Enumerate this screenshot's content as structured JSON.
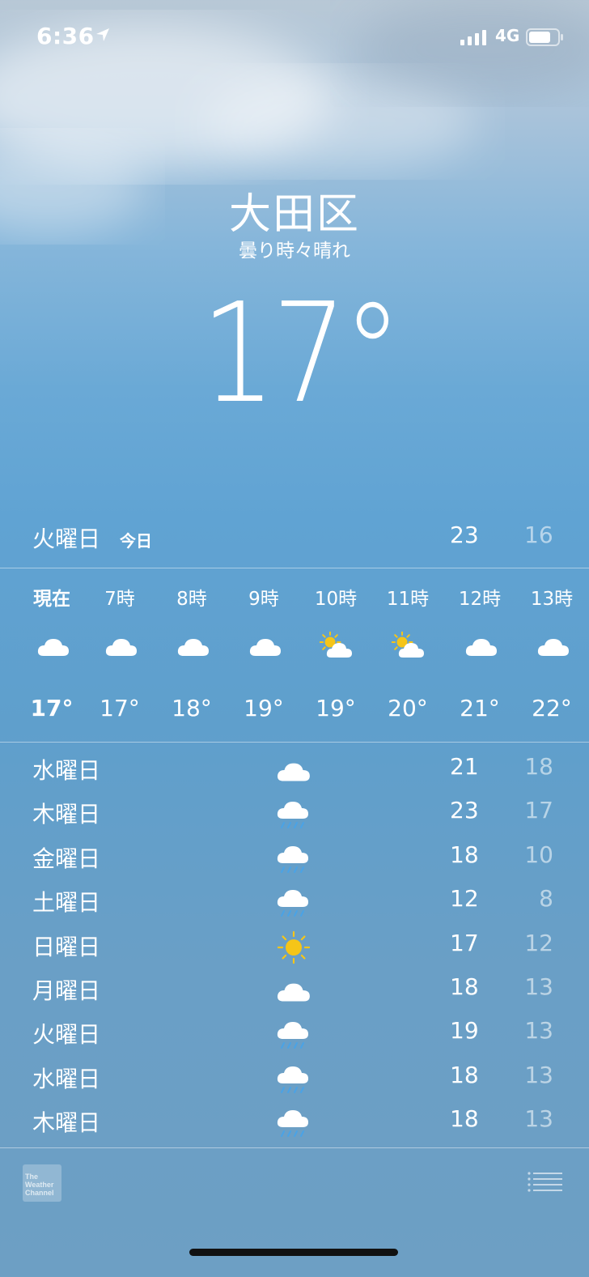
{
  "status_bar": {
    "time": "6:36",
    "network": "4G"
  },
  "location": {
    "city": "大田区",
    "condition": "曇り時々晴れ",
    "temperature": "17°"
  },
  "today": {
    "day": "火曜日",
    "label": "今日",
    "high": "23",
    "low": "16"
  },
  "hourly": [
    {
      "time": "現在",
      "icon": "cloud-icon",
      "temp": "17°",
      "bold": true
    },
    {
      "time": "7時",
      "icon": "cloud-icon",
      "temp": "17°"
    },
    {
      "time": "8時",
      "icon": "cloud-icon",
      "temp": "18°"
    },
    {
      "time": "9時",
      "icon": "cloud-icon",
      "temp": "19°"
    },
    {
      "time": "10時",
      "icon": "partly-sunny-icon",
      "temp": "19°"
    },
    {
      "time": "11時",
      "icon": "partly-sunny-icon",
      "temp": "20°"
    },
    {
      "time": "12時",
      "icon": "cloud-icon",
      "temp": "21°"
    },
    {
      "time": "13時",
      "icon": "cloud-icon",
      "temp": "22°"
    }
  ],
  "daily": [
    {
      "day": "水曜日",
      "icon": "cloud-icon",
      "high": "21",
      "low": "18"
    },
    {
      "day": "木曜日",
      "icon": "rain-icon",
      "high": "23",
      "low": "17"
    },
    {
      "day": "金曜日",
      "icon": "rain-icon",
      "high": "18",
      "low": "10"
    },
    {
      "day": "土曜日",
      "icon": "rain-icon",
      "high": "12",
      "low": "8"
    },
    {
      "day": "日曜日",
      "icon": "sun-icon",
      "high": "17",
      "low": "12"
    },
    {
      "day": "月曜日",
      "icon": "cloud-icon",
      "high": "18",
      "low": "13"
    },
    {
      "day": "火曜日",
      "icon": "rain-icon",
      "high": "19",
      "low": "13"
    },
    {
      "day": "水曜日",
      "icon": "rain-icon",
      "high": "18",
      "low": "13"
    },
    {
      "day": "木曜日",
      "icon": "rain-icon",
      "high": "18",
      "low": "13"
    }
  ],
  "footer": {
    "logo_text": "The Weather Channel"
  }
}
